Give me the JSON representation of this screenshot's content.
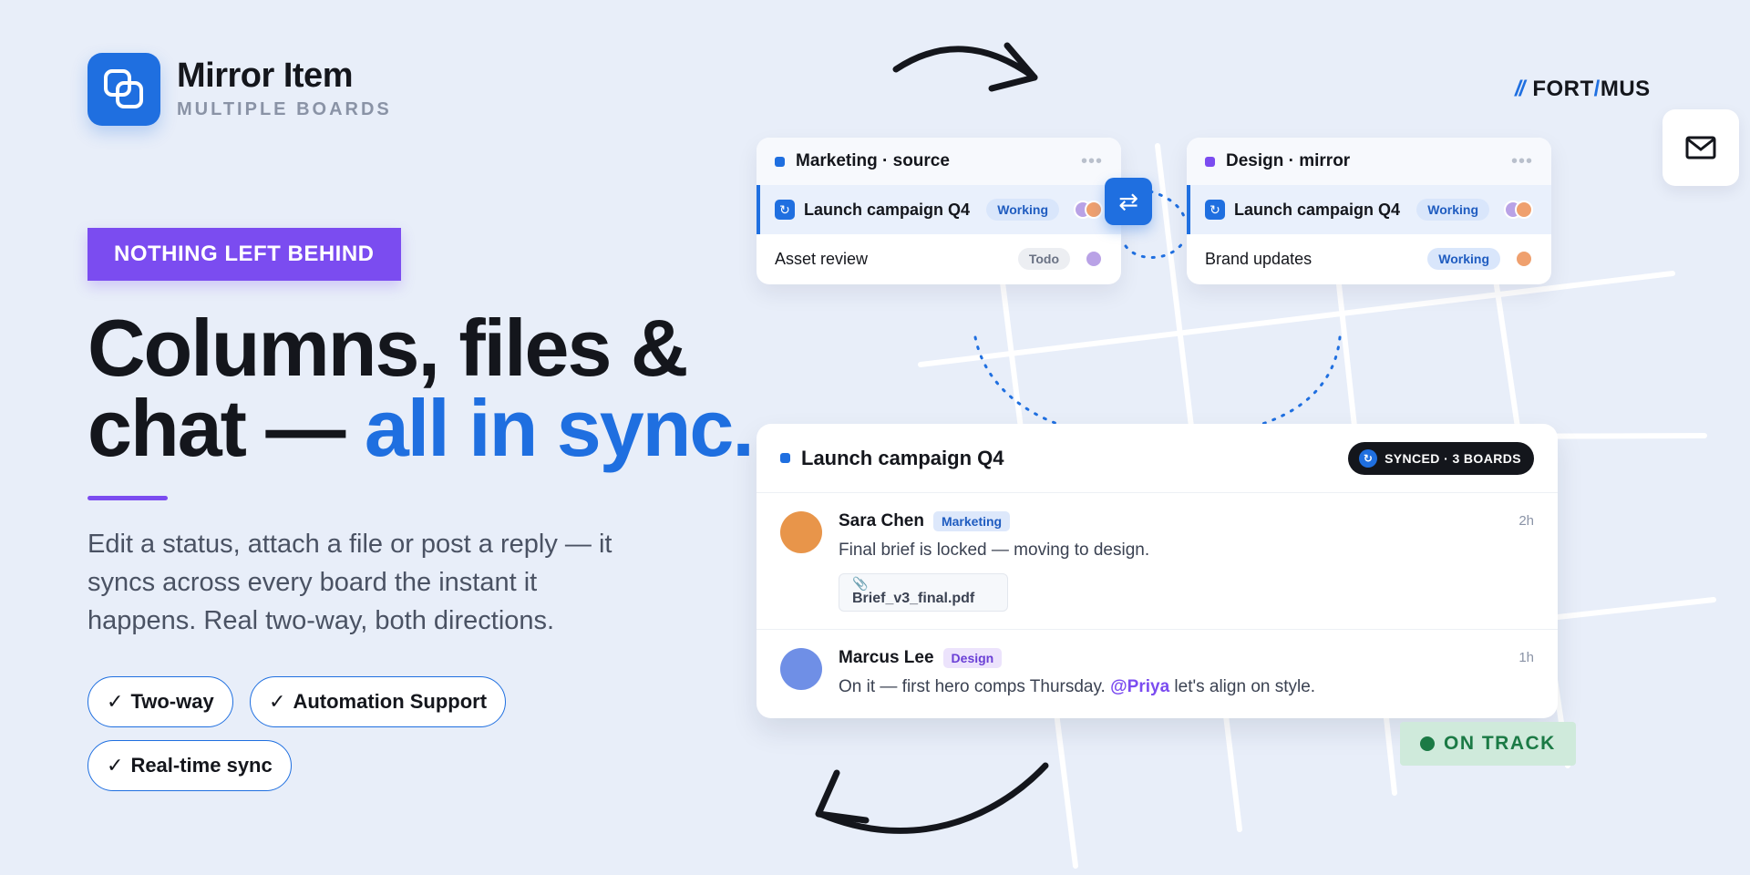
{
  "brand": {
    "title": "Mirror Item",
    "subtitle": "MULTIPLE BOARDS"
  },
  "eyebrow": "NOTHING LEFT BEHIND",
  "headline": {
    "line1": "Columns, files &",
    "line2_plain": "chat —",
    "line2_accent": "all in sync."
  },
  "lede": "Edit a status, attach a file or post a reply — it syncs across every board the instant it happens. Real two-way, both directions.",
  "pills": [
    {
      "check": "✓",
      "label": "Two-way"
    },
    {
      "check": "✓",
      "label": "Automation Support"
    },
    {
      "check": "✓",
      "label": "Real-time sync"
    }
  ],
  "logo": {
    "slashes": "//",
    "part1": "FORT",
    "mark": "/",
    "part2": "MUS"
  },
  "boards": [
    {
      "title": "Marketing · source",
      "dot_color": "#1f6fe0",
      "menu": "•••",
      "rows": [
        {
          "name": "Launch campaign Q4",
          "status": "Working",
          "icon": "sync-icon"
        },
        {
          "name": "Asset review",
          "status": "Todo"
        }
      ]
    },
    {
      "title": "Design · mirror",
      "dot_color": "#7b4cf0",
      "menu": "•••",
      "rows": [
        {
          "name": "Launch campaign Q4",
          "status": "Working",
          "icon": "sync-icon"
        },
        {
          "name": "Brand updates",
          "status": "Working"
        }
      ]
    }
  ],
  "sync_symbol": "⇄",
  "chat": {
    "title": "Launch campaign Q4",
    "synced_badge": "SYNCED · 3 BOARDS",
    "messages": [
      {
        "author": "Sara Chen",
        "team": "Marketing",
        "time": "2h",
        "text": "Final brief is locked — moving to design.",
        "attachment": "Brief_v3_final.pdf"
      },
      {
        "author": "Marcus Lee",
        "team": "Design",
        "time": "1h",
        "text_before": "On it — first hero comps Thursday.",
        "mention": "@Priya",
        "text_after": "let's align on style."
      }
    ]
  },
  "status_badge": "ON TRACK",
  "colors": {
    "accent": "#1f6fe0",
    "purple": "#7b4cf0",
    "green": "#1b7a45"
  }
}
